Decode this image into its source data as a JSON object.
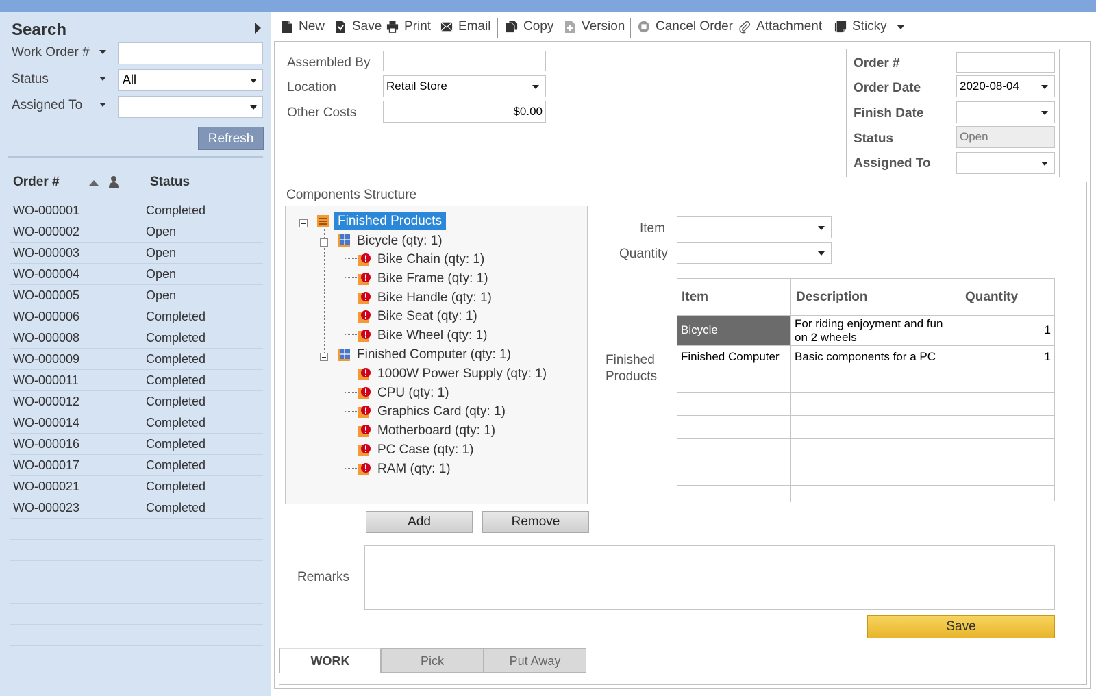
{
  "search": {
    "title": "Search",
    "work_order_label": "Work Order #",
    "work_order_value": "",
    "status_label": "Status",
    "status_value": "All",
    "assigned_label": "Assigned To",
    "assigned_value": "",
    "refresh_label": "Refresh"
  },
  "grid": {
    "col_order": "Order #",
    "col_status": "Status",
    "rows": [
      {
        "order": "WO-000001",
        "status": "Completed"
      },
      {
        "order": "WO-000002",
        "status": "Open"
      },
      {
        "order": "WO-000003",
        "status": "Open"
      },
      {
        "order": "WO-000004",
        "status": "Open"
      },
      {
        "order": "WO-000005",
        "status": "Open"
      },
      {
        "order": "WO-000006",
        "status": "Completed"
      },
      {
        "order": "WO-000008",
        "status": "Completed"
      },
      {
        "order": "WO-000009",
        "status": "Completed"
      },
      {
        "order": "WO-000011",
        "status": "Completed"
      },
      {
        "order": "WO-000012",
        "status": "Completed"
      },
      {
        "order": "WO-000014",
        "status": "Completed"
      },
      {
        "order": "WO-000016",
        "status": "Completed"
      },
      {
        "order": "WO-000017",
        "status": "Completed"
      },
      {
        "order": "WO-000021",
        "status": "Completed"
      },
      {
        "order": "WO-000023",
        "status": "Completed"
      }
    ]
  },
  "toolbar": {
    "new": "New",
    "save": "Save",
    "print": "Print",
    "email": "Email",
    "copy": "Copy",
    "version": "Version",
    "cancel_order": "Cancel Order",
    "attachment": "Attachment",
    "sticky": "Sticky"
  },
  "form": {
    "assembled_by_label": "Assembled By",
    "assembled_by_value": "",
    "location_label": "Location",
    "location_value": "Retail Store",
    "other_costs_label": "Other Costs",
    "other_costs_value": "$0.00",
    "order_num_label": "Order #",
    "order_num_value": "",
    "order_date_label": "Order Date",
    "order_date_value": "2020-08-04",
    "finish_date_label": "Finish Date",
    "finish_date_value": "",
    "status_label": "Status",
    "status_value": "Open",
    "assigned_to_label": "Assigned To",
    "assigned_to_value": ""
  },
  "components": {
    "title": "Components Structure",
    "root": "Finished Products",
    "groups": [
      {
        "label": "Bicycle  (qty: 1)",
        "children": [
          "Bike Chain  (qty: 1)",
          "Bike Frame   (qty: 1)",
          "Bike Handle  (qty: 1)",
          "Bike Seat  (qty: 1)",
          "Bike Wheel  (qty: 1)"
        ]
      },
      {
        "label": "Finished Computer  (qty: 1)",
        "children": [
          "1000W Power Supply  (qty: 1)",
          "CPU  (qty: 1)",
          "Graphics Card  (qty: 1)",
          "Motherboard  (qty: 1)",
          "PC Case  (qty: 1)",
          "RAM  (qty: 1)"
        ]
      }
    ],
    "item_label": "Item",
    "quantity_label": "Quantity",
    "finished_products_label": "Finished Products",
    "add_label": "Add",
    "remove_label": "Remove"
  },
  "fp_table": {
    "col_item": "Item",
    "col_description": "Description",
    "col_quantity": "Quantity",
    "rows": [
      {
        "item": "Bicycle",
        "description": "For riding enjoyment and fun on 2 wheels",
        "quantity": "1"
      },
      {
        "item": "Finished Computer",
        "description": "Basic components for a PC",
        "quantity": "1"
      }
    ]
  },
  "remarks_label": "Remarks",
  "save_label": "Save",
  "tabs": [
    "WORK",
    "Pick",
    "Put Away"
  ],
  "colors": {
    "topbar": "#7ea6dc",
    "left_panel": "#d6e3f3",
    "tree_selection": "#2b87d8",
    "save_button": "#eec23c",
    "selected_row": "#6b6b6b",
    "error_icon": "#d0021b",
    "node_icon": "#f39a36"
  }
}
